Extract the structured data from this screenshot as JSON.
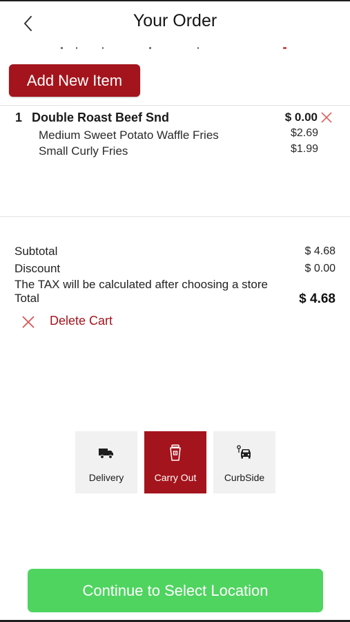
{
  "header": {
    "title": "Your Order"
  },
  "actions": {
    "add_item_label": "Add New Item",
    "delete_cart_label": "Delete Cart",
    "continue_label": "Continue to Select Location"
  },
  "order": {
    "items": [
      {
        "quantity": "1",
        "name": "Double Roast Beef Snd",
        "price": "$ 0.00",
        "modifiers": [
          {
            "name": "Medium Sweet Potato Waffle Fries",
            "price": "$2.69"
          },
          {
            "name": "Small Curly Fries",
            "price": "$1.99"
          }
        ]
      }
    ]
  },
  "summary": {
    "subtotal_label": "Subtotal",
    "subtotal_value": "$ 4.68",
    "discount_label": "Discount",
    "discount_value": "$ 0.00",
    "tax_note": "The TAX will be calculated after choosing a store",
    "total_label": "Total",
    "total_value": "$ 4.68"
  },
  "order_types": [
    {
      "label": "Delivery",
      "icon": "truck-icon",
      "selected": false
    },
    {
      "label": "Carry Out",
      "icon": "cup-icon",
      "selected": true
    },
    {
      "label": "CurbSide",
      "icon": "car-icon",
      "selected": false
    }
  ],
  "colors": {
    "brand_red": "#a4141c",
    "continue_green": "#4fd460",
    "mode_bg": "#f1f1f1"
  }
}
